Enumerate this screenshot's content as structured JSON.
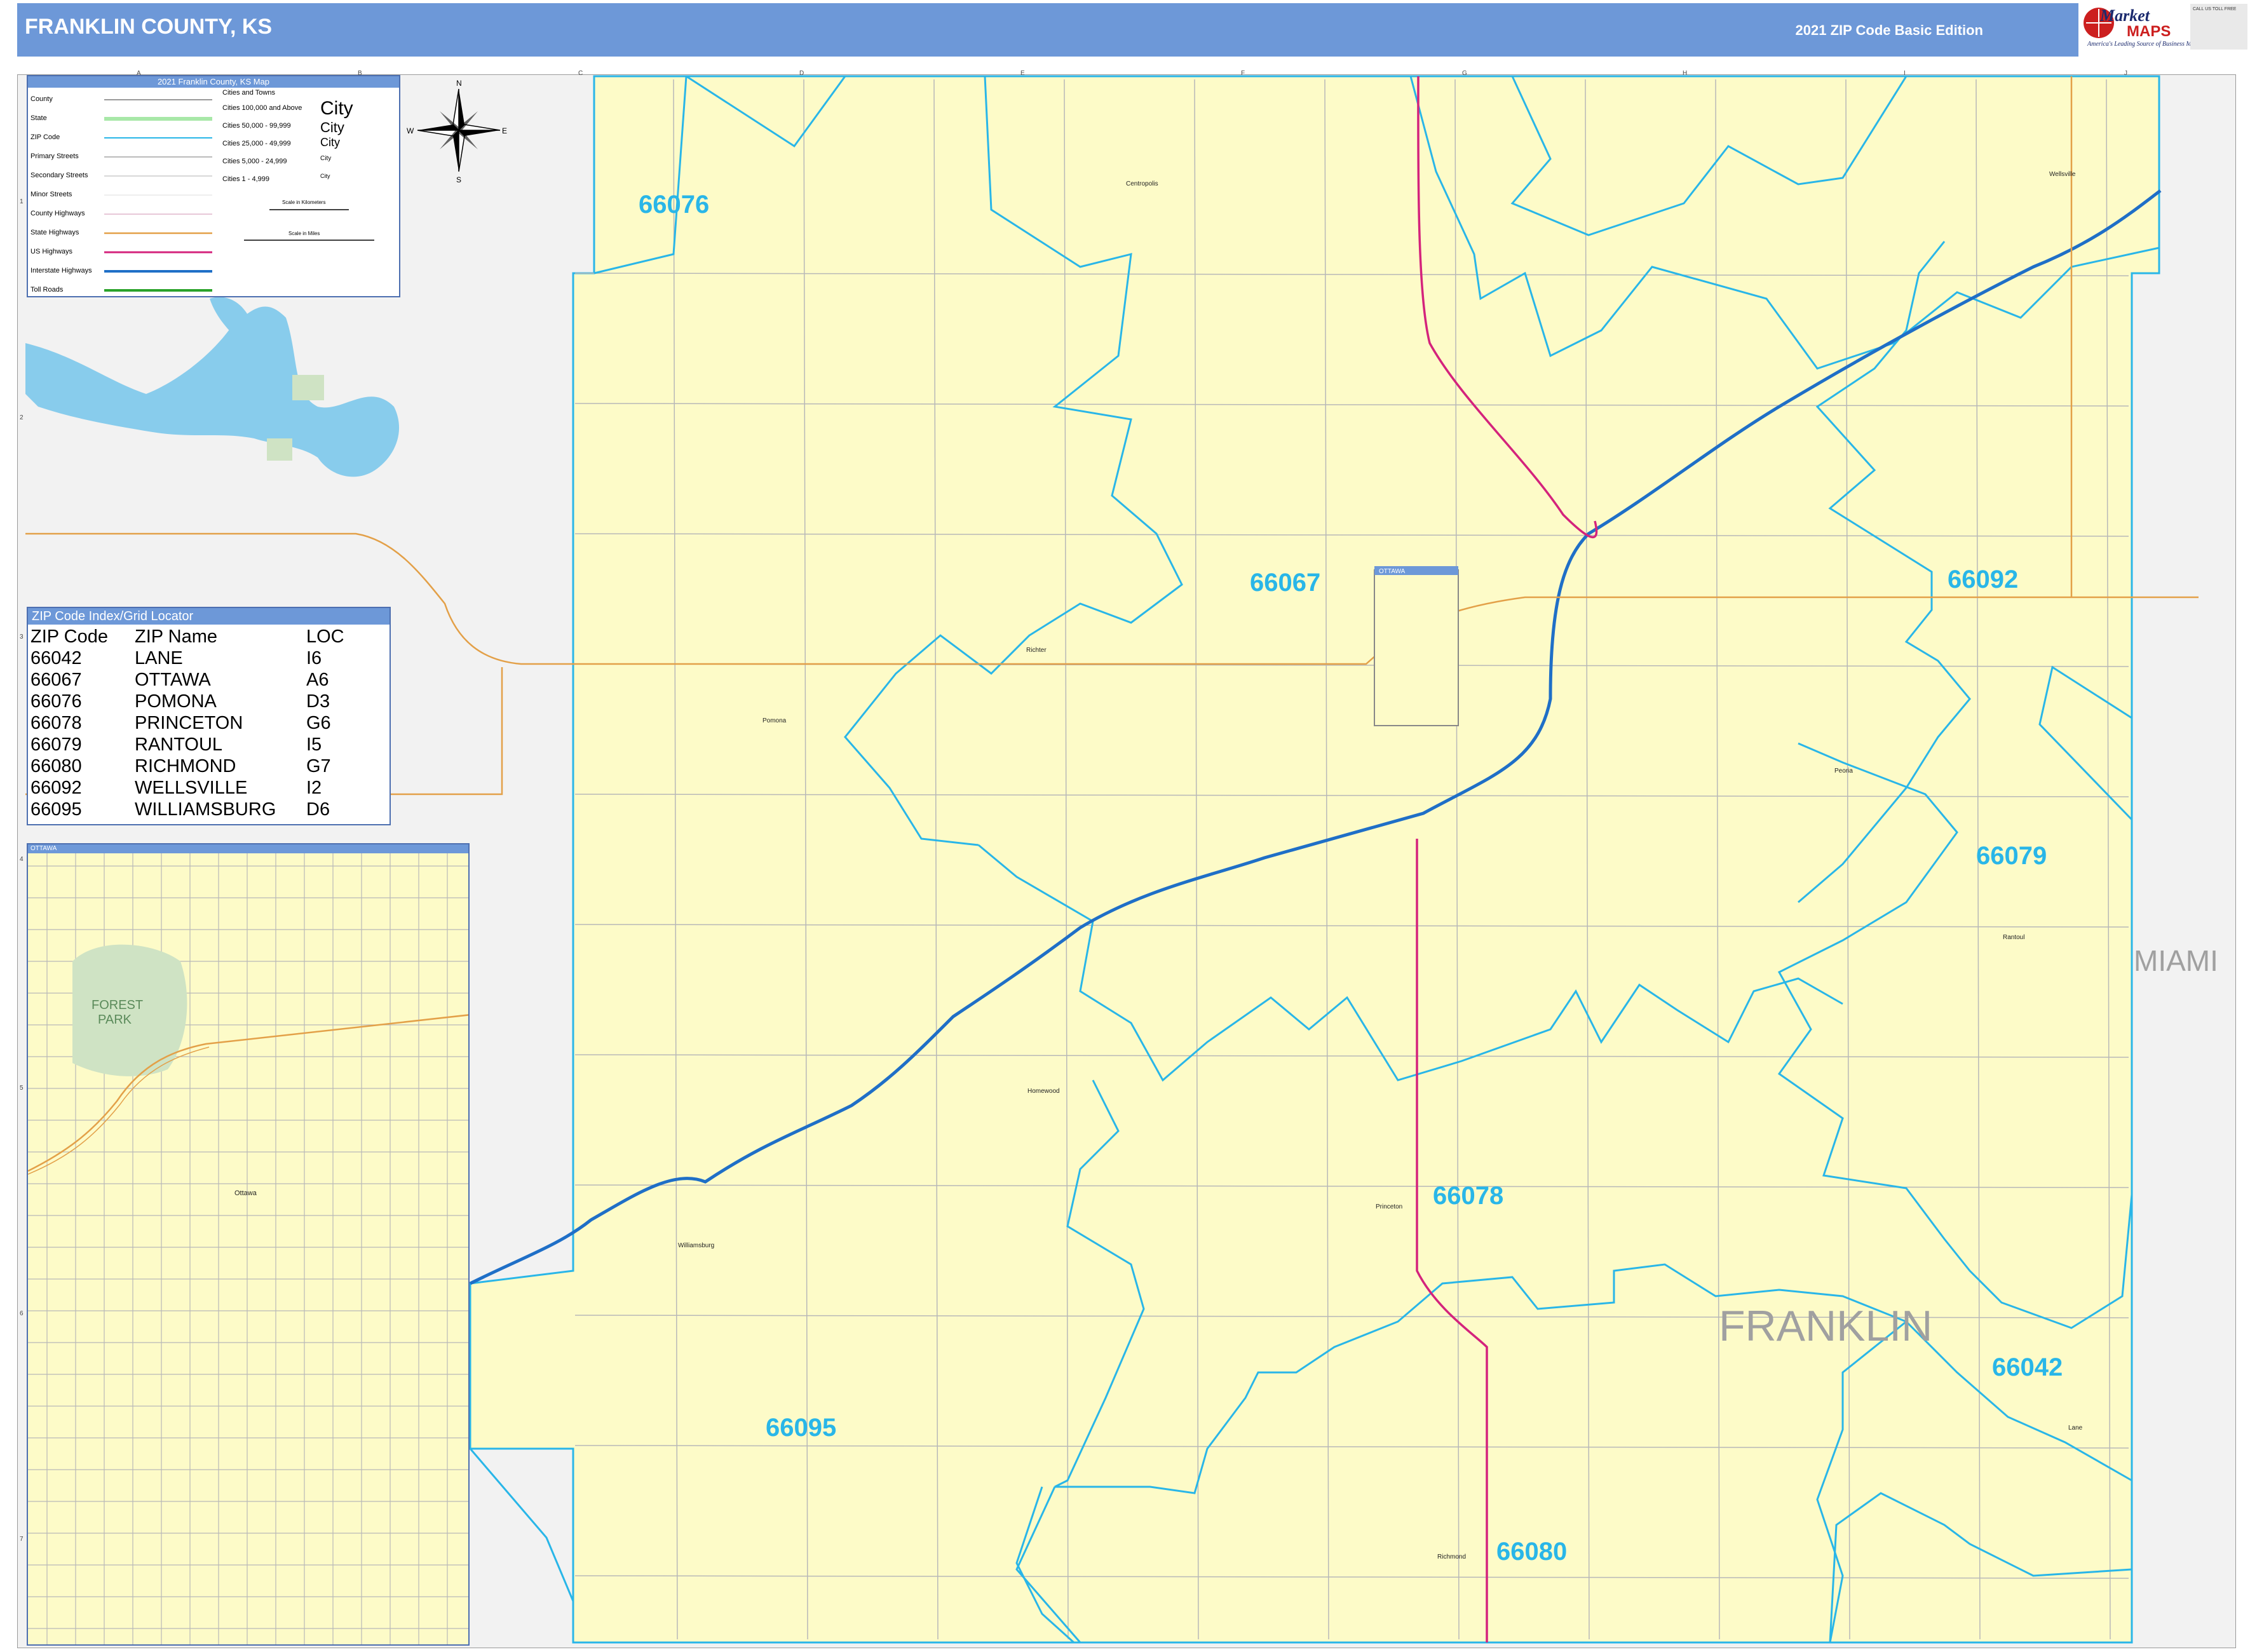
{
  "header": {
    "title": "FRANKLIN COUNTY, KS",
    "edition": "2021 ZIP Code Basic Edition",
    "logo_market": "Market",
    "logo_maps": "MAPS",
    "logo_tagline": "America's Leading Source of Business Maps",
    "contact_text": "CALL US TOLL FREE"
  },
  "legend": {
    "title": "2021 Franklin County, KS Map",
    "items": [
      "County",
      "State",
      "ZIP Code",
      "Primary Streets",
      "Secondary Streets",
      "Minor Streets",
      "County Highways",
      "State Highways",
      "US Highways",
      "Interstate Highways",
      "Toll Roads"
    ],
    "cities_header": "Cities and Towns",
    "city_sizes": [
      "Cities 100,000 and Above",
      "Cities 50,000 - 99,999",
      "Cities 25,000 - 49,999",
      "Cities 5,000 - 24,999",
      "Cities 1 - 4,999"
    ],
    "city_sample": "City",
    "scale_km_label": "Scale in Kilometers",
    "scale_mi_label": "Scale in Miles"
  },
  "compass": {
    "n": "N",
    "s": "S",
    "e": "E",
    "w": "W"
  },
  "zip_index": {
    "title": "ZIP Code Index/Grid Locator",
    "headers": [
      "ZIP Code",
      "ZIP Name",
      "LOC"
    ],
    "rows": [
      [
        "66042",
        "LANE",
        "I6"
      ],
      [
        "66067",
        "OTTAWA",
        "A6"
      ],
      [
        "66076",
        "POMONA",
        "D3"
      ],
      [
        "66078",
        "PRINCETON",
        "G6"
      ],
      [
        "66079",
        "RANTOUL",
        "I5"
      ],
      [
        "66080",
        "RICHMOND",
        "G7"
      ],
      [
        "66092",
        "WELLSVILLE",
        "I2"
      ],
      [
        "66095",
        "WILLIAMSBURG",
        "D6"
      ]
    ]
  },
  "inset": {
    "title": "OTTAWA",
    "park_label_1": "FOREST",
    "park_label_2": "PARK",
    "city_label": "Ottawa"
  },
  "map": {
    "zip_labels": [
      "66076",
      "66067",
      "66092",
      "66079",
      "66078",
      "66042",
      "66095",
      "66080"
    ],
    "county_label": "FRANKLIN",
    "neighbor_label": "MIAMI",
    "ottawa_box_label": "OTTAWA",
    "towns": [
      "Centropolis",
      "Wellsville",
      "Richter",
      "Pomona",
      "Peoria",
      "Rantoul",
      "Homewood",
      "Princeton",
      "Williamsburg",
      "Lane",
      "Richmond"
    ],
    "grid_columns": [
      "A",
      "B",
      "C",
      "D",
      "E",
      "F",
      "G",
      "H",
      "I",
      "J"
    ],
    "grid_rows": [
      "1",
      "2",
      "3",
      "4",
      "5",
      "6",
      "7"
    ]
  },
  "colors": {
    "header_bg": "#6d98d8",
    "county_fill": "#fdfbc8",
    "zip_boundary": "#29b6e8",
    "zip_label": "#29b6e8",
    "interstate": "#1f6fc7",
    "us_highway": "#d4237c",
    "state_highway": "#e3a048",
    "water": "#88ccec"
  }
}
